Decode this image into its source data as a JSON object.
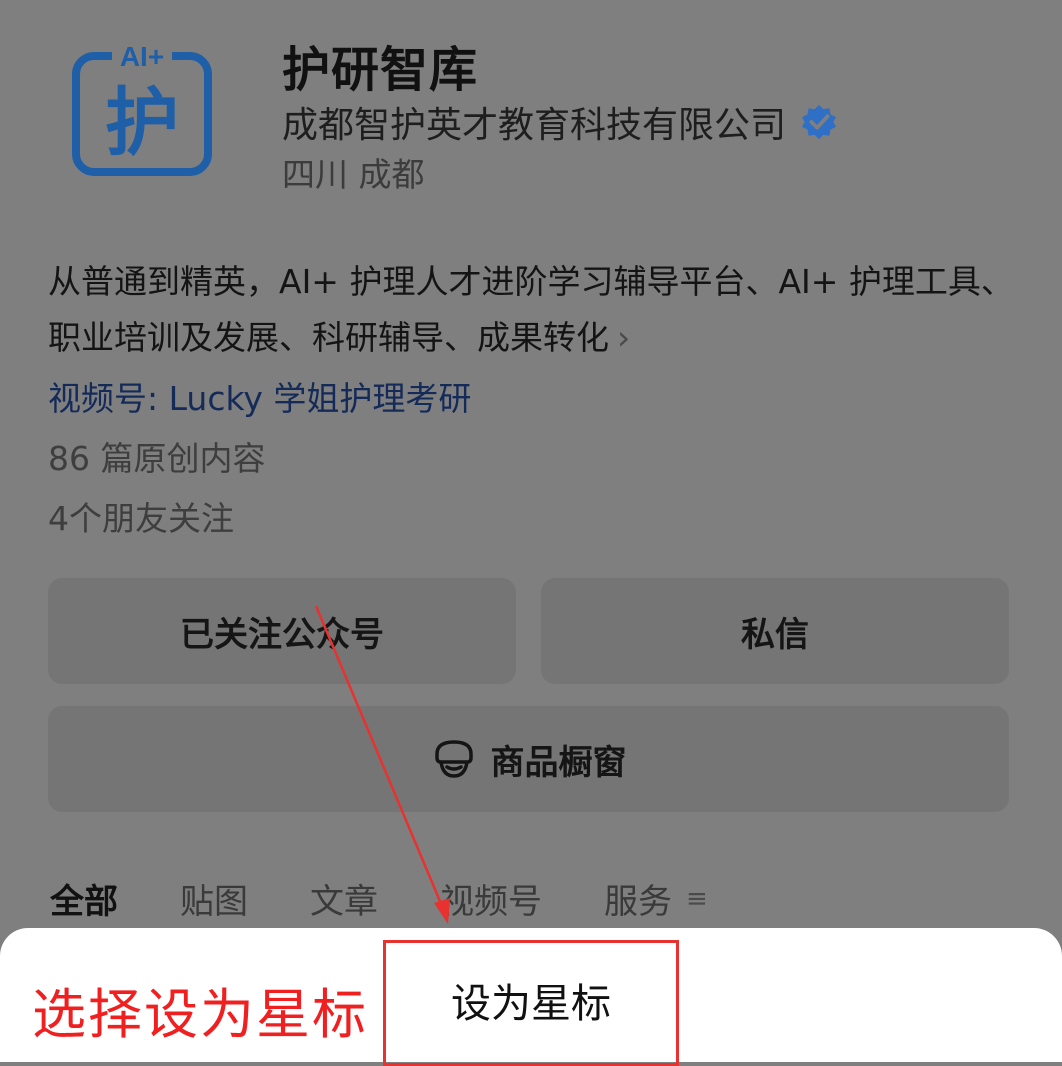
{
  "profile": {
    "name": "护研智库",
    "company": "成都智护英才教育科技有限公司",
    "location": "四川 成都",
    "description": "从普通到精英，AI+ 护理人才进阶学习辅导平台、AI+ 护理工具、职业培训及发展、科研辅导、成果转化",
    "more_icon": "chevron-right-icon",
    "channel": "视频号: Lucky 学姐护理考研",
    "originals": "86 篇原创内容",
    "friends": "4个朋友关注",
    "logo_text": "AI+护",
    "verified_icon": "verified-badge-icon",
    "accent_color": "#2f6fc6"
  },
  "buttons": {
    "followed": "已关注公众号",
    "message": "私信",
    "shop": "商品橱窗",
    "shop_icon": "shop-window-icon"
  },
  "tabs": [
    "全部",
    "贴图",
    "文章",
    "视频号",
    "服务"
  ],
  "tabs_menu_icon": "menu-lines-icon",
  "sheet": {
    "option": "设为星标"
  },
  "annotation": {
    "text": "选择设为星标",
    "color": "#f02020"
  }
}
